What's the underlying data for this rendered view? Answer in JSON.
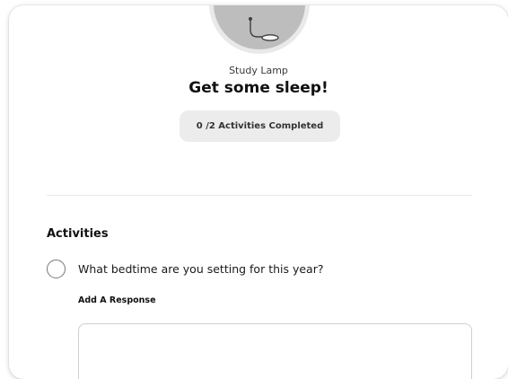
{
  "item": {
    "icon": "lamp-icon",
    "subtitle": "Study Lamp",
    "title": "Get some sleep!"
  },
  "progress": {
    "completed": 0,
    "total": 2,
    "label": "0 /2 Activities Completed"
  },
  "activities": {
    "heading": "Activities",
    "items": [
      {
        "question": "What bedtime are you setting for this year?",
        "completed": false,
        "response_label": "Add A Response",
        "response_value": ""
      }
    ]
  },
  "colors": {
    "avatar_bg": "#bdbdbd",
    "avatar_ring": "#e9e9e9",
    "progress_pill_bg": "#ececec",
    "text_primary": "#111111"
  }
}
